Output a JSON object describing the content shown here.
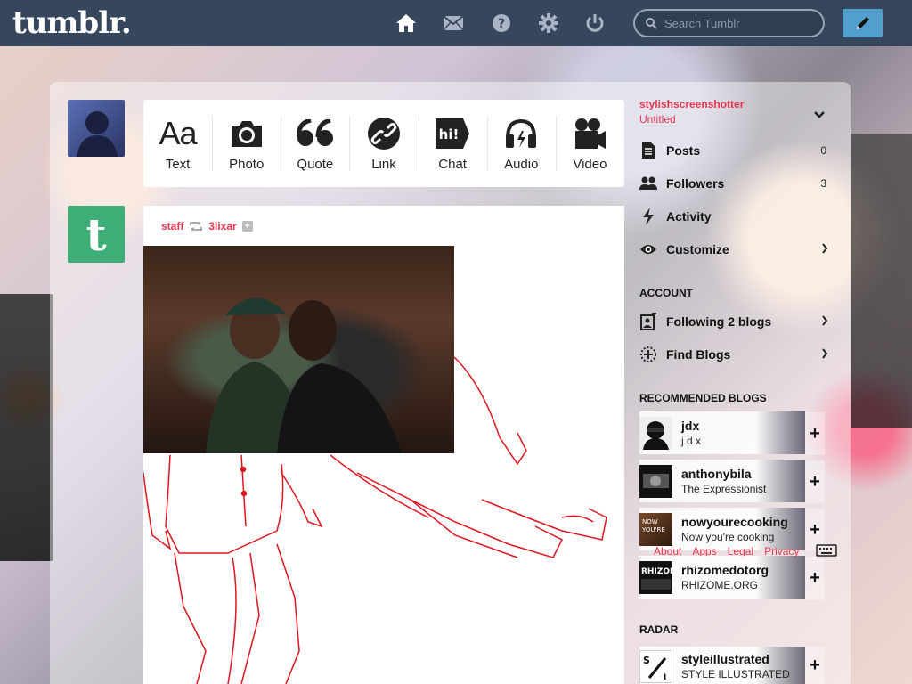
{
  "header": {
    "logo": "tumblr.",
    "search_placeholder": "Search Tumblr",
    "nav_icons": [
      "home-icon",
      "mail-icon",
      "help-icon",
      "gear-icon",
      "power-icon"
    ],
    "compose_icon": "pencil-icon"
  },
  "composer": {
    "types": [
      {
        "label": "Text",
        "icon": "text-icon"
      },
      {
        "label": "Photo",
        "icon": "camera-icon"
      },
      {
        "label": "Quote",
        "icon": "quote-icon"
      },
      {
        "label": "Link",
        "icon": "link-icon"
      },
      {
        "label": "Chat",
        "icon": "chat-icon"
      },
      {
        "label": "Audio",
        "icon": "headphones-icon"
      },
      {
        "label": "Video",
        "icon": "video-camera-icon"
      }
    ]
  },
  "post": {
    "author": "staff",
    "reblogged_from": "3lixar",
    "reblog_icon": "reblog-icon"
  },
  "sidebar": {
    "blog_name": "stylishscreenshotter",
    "blog_title": "Untitled",
    "rows": [
      {
        "label": "Posts",
        "count": "0",
        "icon": "posts-icon"
      },
      {
        "label": "Followers",
        "count": "3",
        "icon": "followers-icon"
      },
      {
        "label": "Activity",
        "count": "",
        "icon": "activity-icon"
      },
      {
        "label": "Customize",
        "count": "",
        "icon": "eye-icon"
      }
    ],
    "account_heading": "ACCOUNT",
    "account_rows": [
      {
        "label": "Following 2 blogs",
        "icon": "following-icon"
      },
      {
        "label": "Find Blogs",
        "icon": "find-blogs-icon"
      }
    ],
    "recommended_heading": "RECOMMENDED BLOGS",
    "recommended": [
      {
        "name": "jdx",
        "subtitle": "j d x"
      },
      {
        "name": "anthonybila",
        "subtitle": "The Expressionist"
      },
      {
        "name": "nowyourecooking",
        "subtitle": "Now you're cooking"
      },
      {
        "name": "rhizomedotorg",
        "subtitle": "RHIZOME.ORG"
      }
    ],
    "radar_heading": "RADAR",
    "radar": {
      "name": "styleillustrated",
      "subtitle": "STYLE ILLUSTRATED"
    },
    "footer_links": [
      "About",
      "Apps",
      "Legal",
      "Privacy"
    ]
  },
  "colors": {
    "header_bg": "#36465d",
    "accent_red": "#e8364f",
    "compose_blue": "#529ecc",
    "staff_green": "#3eae76"
  }
}
